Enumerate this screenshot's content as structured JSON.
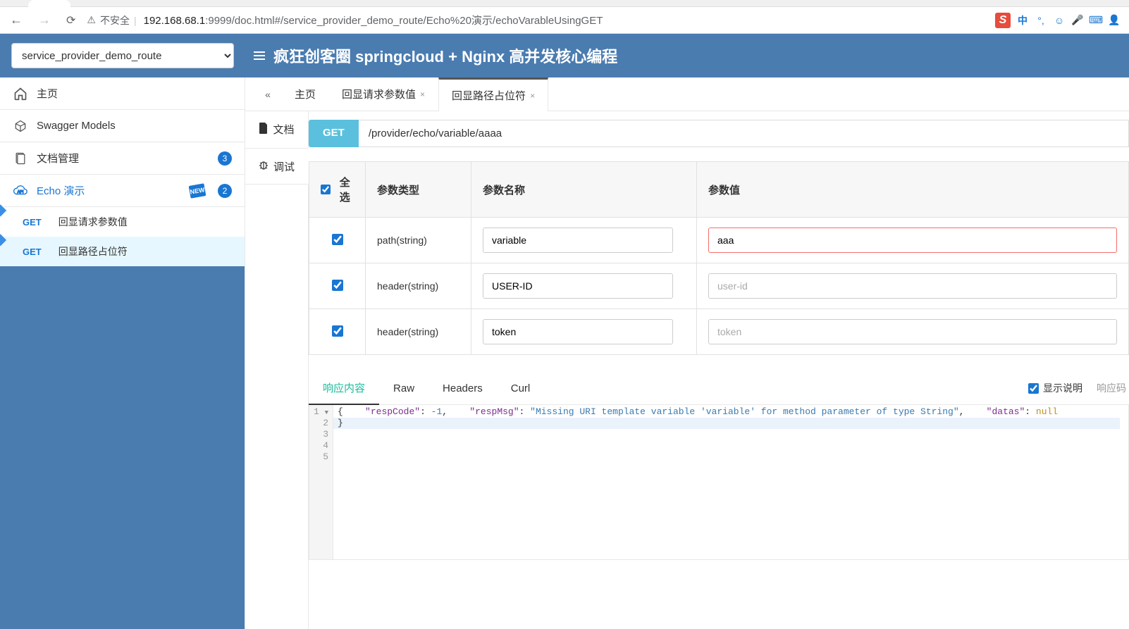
{
  "browser": {
    "security_label": "不安全",
    "url_host": "192.168.68.1",
    "url_rest": ":9999/doc.html#/service_provider_demo_route/Echo%20演示/echoVarableUsingGET",
    "toolbar": {
      "lang": "中"
    }
  },
  "header": {
    "service_select": "service_provider_demo_route",
    "app_title": "疯狂创客圈 springcloud + Nginx 高并发核心编程"
  },
  "sidebar": {
    "home": "主页",
    "swagger_models": "Swagger Models",
    "doc_mgmt": {
      "label": "文档管理",
      "count": "3"
    },
    "echo_demo": {
      "label": "Echo 演示",
      "count": "2",
      "new": "NEW"
    },
    "apis": [
      {
        "method": "GET",
        "name": "回显请求参数值"
      },
      {
        "method": "GET",
        "name": "回显路径占位符"
      }
    ]
  },
  "tabs": {
    "collapse": "«",
    "items": [
      {
        "label": "主页",
        "closable": false
      },
      {
        "label": "回显请求参数值",
        "closable": true
      },
      {
        "label": "回显路径占位符",
        "closable": true,
        "active": true
      }
    ]
  },
  "subtabs": {
    "doc": "文档",
    "debug": "调试"
  },
  "endpoint": {
    "method": "GET",
    "path": "/provider/echo/variable/aaaa"
  },
  "params": {
    "select_all": "全选",
    "col_type": "参数类型",
    "col_name": "参数名称",
    "col_value": "参数值",
    "rows": [
      {
        "type": "path(string)",
        "name": "variable",
        "value": "aaa",
        "value_ph": "",
        "invalid": true
      },
      {
        "type": "header(string)",
        "name": "USER-ID",
        "value": "",
        "value_ph": "user-id",
        "invalid": false
      },
      {
        "type": "header(string)",
        "name": "token",
        "value": "",
        "value_ph": "token",
        "invalid": false
      }
    ]
  },
  "response_tabs": {
    "content": "响应内容",
    "raw": "Raw",
    "headers": "Headers",
    "curl": "Curl",
    "show_desc": "显示说明",
    "resp_code_label": "响应码"
  },
  "response_body": {
    "lines": [
      "1",
      "2",
      "3",
      "4",
      "5"
    ],
    "json": {
      "respCode": -1,
      "respMsg": "Missing URI template variable 'variable' for method parameter of type String",
      "datas": null
    }
  }
}
